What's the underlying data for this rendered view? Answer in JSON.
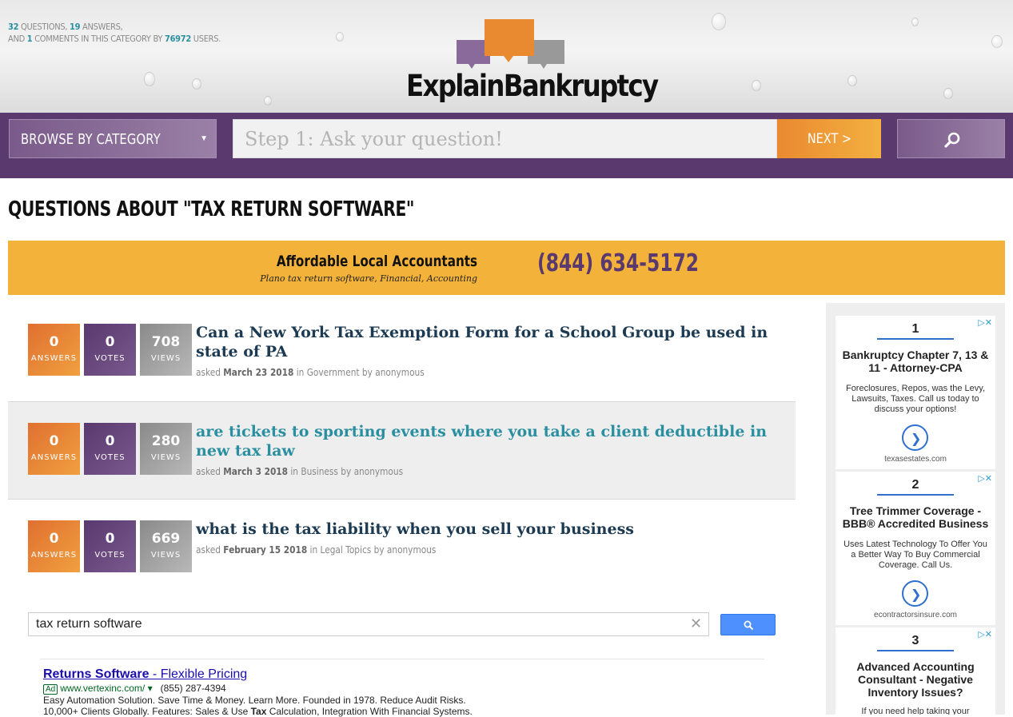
{
  "stats": {
    "questions": "32",
    "questions_label": " QUESTIONS, ",
    "answers": "19",
    "answers_label": " ANSWERS,",
    "and_label": "AND ",
    "comments": "1",
    "comments_label": " COMMENTS IN THIS CATEGORY BY ",
    "users": "76972",
    "users_label": " USERS."
  },
  "brand": {
    "name": "ExplainBankruptcy"
  },
  "nav": {
    "browse_label": "BROWSE BY CATEGORY",
    "ask_placeholder": "Step 1: Ask your question!",
    "next_label": "NEXT >"
  },
  "page_title": "QUESTIONS ABOUT \"TAX RETURN SOFTWARE\"",
  "promo": {
    "title": "Affordable Local Accountants",
    "subtitle": "Plano tax return software, Financial, Accounting",
    "phone": "(844) 634-5172"
  },
  "questions": [
    {
      "answers": "0",
      "answers_label": "ANSWERS",
      "votes": "0",
      "votes_label": "VOTES",
      "views": "708",
      "views_label": "VIEWS",
      "title": "Can a New York Tax Exemption Form for a School Group be used in state of PA",
      "asked": "asked ",
      "date": "March 23 2018",
      "in": " in ",
      "category": "Government",
      "by": " by anonymous"
    },
    {
      "answers": "0",
      "answers_label": "ANSWERS",
      "votes": "0",
      "votes_label": "VOTES",
      "views": "280",
      "views_label": "VIEWS",
      "title": "are tickets to sporting events where you take a client deductible in new tax law",
      "asked": "asked ",
      "date": "March 3 2018",
      "in": " in ",
      "category": "Business",
      "by": " by anonymous"
    },
    {
      "answers": "0",
      "answers_label": "ANSWERS",
      "votes": "0",
      "votes_label": "VOTES",
      "views": "669",
      "views_label": "VIEWS",
      "title": "what is the tax liability when you sell your business",
      "asked": "asked ",
      "date": "February 15 2018",
      "in": " in ",
      "category": "Legal Topics",
      "by": " by anonymous"
    }
  ],
  "search": {
    "value": "tax return software",
    "clear": "✕"
  },
  "text_ad": {
    "title_strong": "Returns Software",
    "title_rest": " - Flexible Pricing",
    "badge": "Ad",
    "url": "www.vertexinc.com/",
    "url_arrow": "▾",
    "phone": "(855) 287-4394",
    "line1": "Easy Automation Solution. Save Time & Money. Learn More. Founded in 1978. Reduce Audit Risks.",
    "line2_a": "10,000+ Clients Globally. Features: Sales & Use ",
    "line2_b": "Tax",
    "line2_c": " Calculation, Integration With Financial Systems."
  },
  "side_ads": [
    {
      "num": "1",
      "headline": "Bankruptcy Chapter 7, 13 & 11 - Attorney-CPA",
      "body": "Foreclosures, Repos, was the Levy, Lawsuits, Taxes. Call us today to discuss your options!",
      "domain": "texasestates.com"
    },
    {
      "num": "2",
      "headline": "Tree Trimmer Coverage - BBB® Accredited Business",
      "body": "Uses Latest Technology To Offer You a Better Way To Buy Commercial Coverage. Call Us.",
      "domain": "econtractorsinsure.com"
    },
    {
      "num": "3",
      "headline": "Advanced Accounting Consultant - Negative Inventory Issues?",
      "body": "If you need help taking your",
      "domain": ""
    }
  ],
  "ad_choices": "▷✕",
  "colors": {
    "purple": "#5a3a6e",
    "orange": "#f3b23a",
    "teal": "#2a8fa0",
    "navy_title": "#1c3a52"
  }
}
